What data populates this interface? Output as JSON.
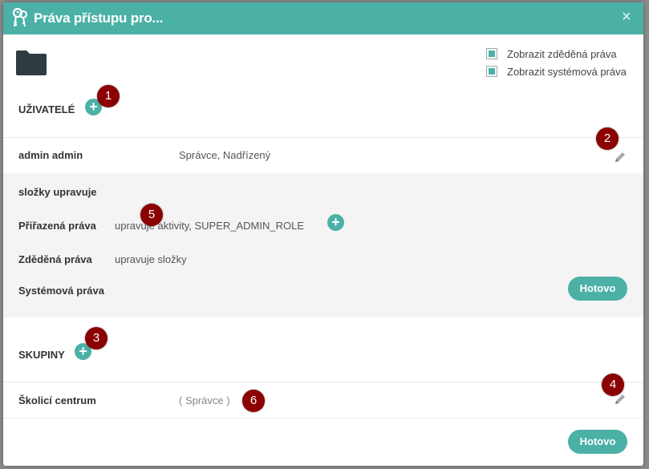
{
  "dialog": {
    "title": "Práva přístupu pro...",
    "close_label": "×"
  },
  "options": {
    "show_inherited": {
      "label": "Zobrazit zděděná práva",
      "checked": true
    },
    "show_system": {
      "label": "Zobrazit systémová práva",
      "checked": true
    }
  },
  "users": {
    "section_title": "UŽIVATELÉ",
    "add_label": "+",
    "items": [
      {
        "name": "admin admin",
        "roles": "Správce, Nadřízený"
      }
    ]
  },
  "detail": {
    "heading": "složky upravuje",
    "assigned_label": "Přiřazená práva",
    "assigned_value": "upravuje aktivity, SUPER_ADMIN_ROLE",
    "assigned_add_label": "+",
    "inherited_label": "Zděděná práva",
    "inherited_value": "upravuje složky",
    "system_label": "Systémová práva",
    "done_label": "Hotovo"
  },
  "groups": {
    "section_title": "SKUPINY",
    "add_label": "+",
    "items": [
      {
        "name": "Školicí centrum",
        "role": "( Správce )"
      }
    ]
  },
  "footer": {
    "done_label": "Hotovo"
  },
  "badges": [
    "1",
    "2",
    "3",
    "4",
    "5",
    "6"
  ],
  "colors": {
    "accent": "#4bb1a7",
    "badge": "#8b0000"
  },
  "icons": {
    "title": "keys-icon",
    "folder": "folder-icon",
    "edit": "pencil-icon",
    "close": "close-icon"
  }
}
